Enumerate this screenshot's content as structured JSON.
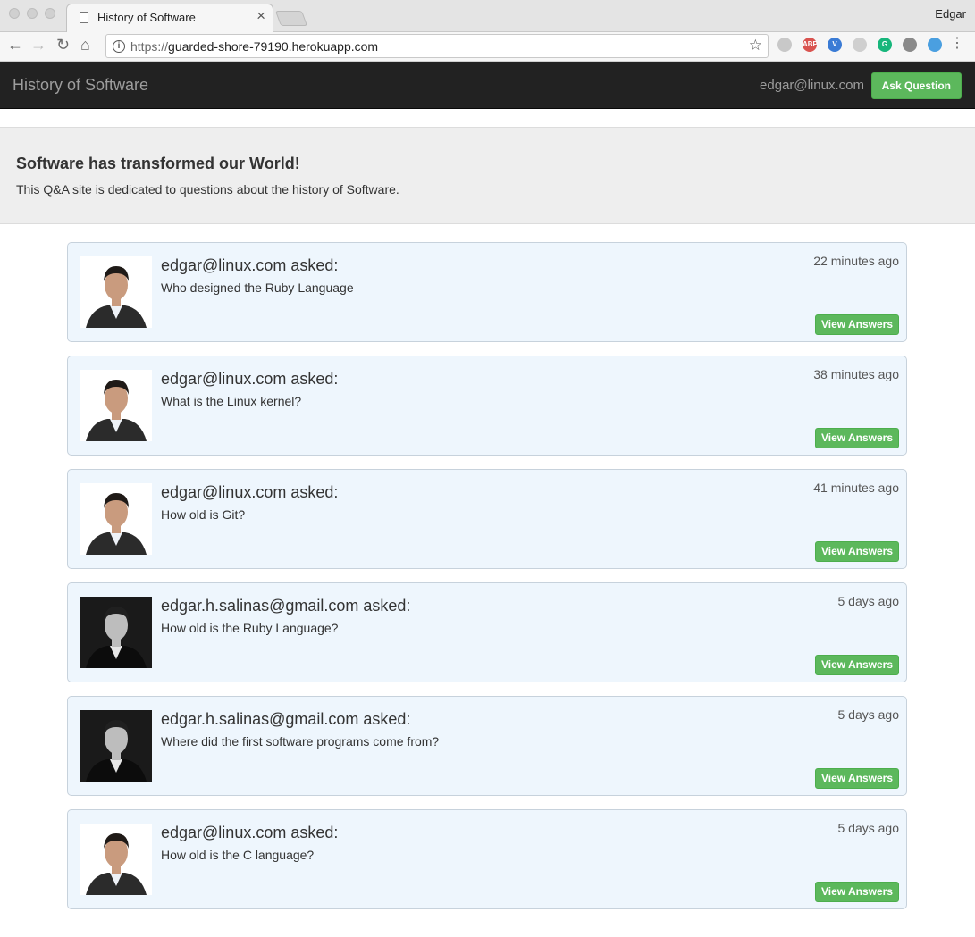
{
  "browser": {
    "tab_title": "History of Software",
    "tab_close": "×",
    "user_label": "Edgar",
    "url_scheme": "https://",
    "url_host": "guarded-shore-79190.herokuapp.com",
    "nav_back": "←",
    "nav_forward": "→",
    "nav_reload": "↻",
    "nav_home": "⌂",
    "star": "☆",
    "menu": "⋮",
    "extensions": [
      {
        "icon": "drive-icon",
        "color": "#c8c8c8",
        "text": ""
      },
      {
        "icon": "adblock-plus-icon",
        "color": "#d9534f",
        "text": "ABP"
      },
      {
        "icon": "vimium-icon",
        "color": "#3a7bd5",
        "text": "V"
      },
      {
        "icon": "extension-icon",
        "color": "#cfcfcf",
        "text": ""
      },
      {
        "icon": "grammarly-icon",
        "color": "#17b67b",
        "text": "G"
      },
      {
        "icon": "lightbulb-icon",
        "color": "#8a8a8a",
        "text": ""
      },
      {
        "icon": "reader-icon",
        "color": "#4a9fe0",
        "text": ""
      }
    ]
  },
  "navbar": {
    "brand": "History of Software",
    "user_email": "edgar@linux.com",
    "ask_button": "Ask Question"
  },
  "jumbotron": {
    "title": "Software has transformed our World!",
    "text": "This Q&A site is dedicated to questions about the history of Software."
  },
  "questions": [
    {
      "asker": "edgar@linux.com asked:",
      "question": "Who designed the Ruby Language",
      "time": "22 minutes ago",
      "button": "View Answers",
      "avatar": "light"
    },
    {
      "asker": "edgar@linux.com asked:",
      "question": "What is the Linux kernel?",
      "time": "38 minutes ago",
      "button": "View Answers",
      "avatar": "light"
    },
    {
      "asker": "edgar@linux.com asked:",
      "question": "How old is Git?",
      "time": "41 minutes ago",
      "button": "View Answers",
      "avatar": "light"
    },
    {
      "asker": "edgar.h.salinas@gmail.com asked:",
      "question": "How old is the Ruby Language?",
      "time": "5 days ago",
      "button": "View Answers",
      "avatar": "dark"
    },
    {
      "asker": "edgar.h.salinas@gmail.com asked:",
      "question": "Where did the first software programs come from?",
      "time": "5 days ago",
      "button": "View Answers",
      "avatar": "dark"
    },
    {
      "asker": "edgar@linux.com asked:",
      "question": "How old is the C language?",
      "time": "5 days ago",
      "button": "View Answers",
      "avatar": "light"
    }
  ],
  "colors": {
    "navbar_bg": "#222222",
    "success_green": "#5cb85c",
    "card_bg": "#eef6fd",
    "jumbotron_bg": "#eeeeee"
  }
}
